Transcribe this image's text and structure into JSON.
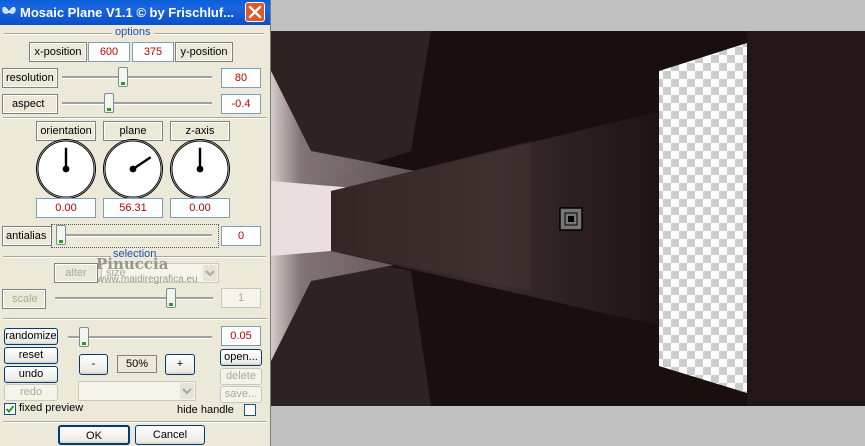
{
  "window": {
    "title": "Mosaic Plane V1.1 © by Frischluf...",
    "close_label": "✕"
  },
  "options": {
    "header": "options",
    "x_label": "x-position",
    "x_value": "600",
    "y_value": "375",
    "y_label": "y-position",
    "resolution": {
      "label": "resolution",
      "value": "80",
      "slider_fraction": 0.4
    },
    "aspect": {
      "label": "aspect",
      "value": "-0.4",
      "slider_fraction": 0.3
    }
  },
  "dials": [
    {
      "label": "orientation",
      "value": "0.00",
      "angle_deg": 0
    },
    {
      "label": "plane",
      "value": "56.31",
      "angle_deg": 56.31
    },
    {
      "label": "z-axis",
      "value": "0.00",
      "angle_deg": 0
    }
  ],
  "antialias": {
    "label": "antialias",
    "value": "0",
    "slider_fraction": 0.0
  },
  "selection": {
    "header": "selection",
    "alter_label": "alter",
    "size_label": "size",
    "scale_label": "scale",
    "scale_value": "1",
    "scale_fraction": 0.75
  },
  "watermark": {
    "line1": "Pinuccia",
    "line2": "www.maidiregrafica.eu"
  },
  "randomize": {
    "label": "randomize",
    "value": "0.05",
    "slider_fraction": 0.03
  },
  "buttons": {
    "reset": "reset",
    "undo": "undo",
    "redo": "redo",
    "minus": "-",
    "zoom": "50%",
    "plus": "+",
    "open": "open...",
    "delete": "delete",
    "save": "save...",
    "ok": "OK",
    "cancel": "Cancel"
  },
  "fixed_preview": {
    "label": "fixed preview",
    "checked": true
  },
  "hide_handle": {
    "label": "hide handle",
    "checked": false
  },
  "colors": {
    "value_red": "#c00000",
    "title_blue": "#0a5fd8"
  }
}
